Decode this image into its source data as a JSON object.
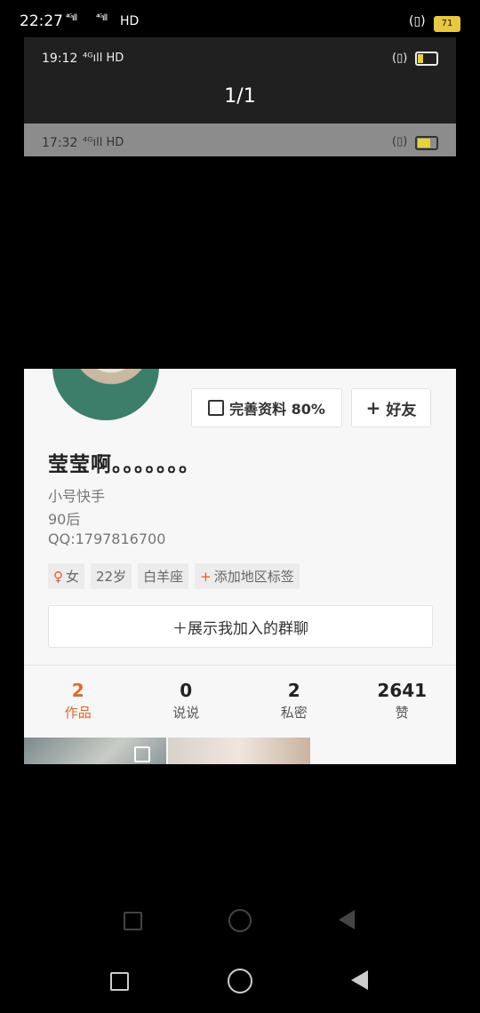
{
  "outer_status": {
    "time": "22:27",
    "signal1": "⁴ᴳıll",
    "signal2": "⁴ᴳıll",
    "hd": "HD",
    "vibrate": "(▯)",
    "battery": "71"
  },
  "viewer": {
    "screenshot_time": "19:12",
    "network": "⁴ᴳıll HD",
    "vibrate": "(▯)",
    "counter": "1/1"
  },
  "inner_status": {
    "time": "17:32",
    "network": "⁴ᴳıll HD",
    "vibrate": "(▯)"
  },
  "profile": {
    "edit_button": "完善资料 80%",
    "friend_button": "好友",
    "name": "莹莹啊。。。。。。。",
    "bio_lines": [
      "小号快手",
      "90后",
      "QQ:1797816700"
    ],
    "tags": {
      "gender": "女",
      "gender_symbol": "♀",
      "age": "22岁",
      "zodiac": "白羊座",
      "add_region": "添加地区标签",
      "add_symbol": "+"
    },
    "groups_button": "＋展示我加入的群聊",
    "stats": [
      {
        "num": "2",
        "label": "作品"
      },
      {
        "num": "0",
        "label": "说说"
      },
      {
        "num": "2",
        "label": "私密"
      },
      {
        "num": "2641",
        "label": "赞"
      }
    ]
  },
  "colors": {
    "accent": "#e0682d",
    "battery_outer": "#e8c840"
  }
}
